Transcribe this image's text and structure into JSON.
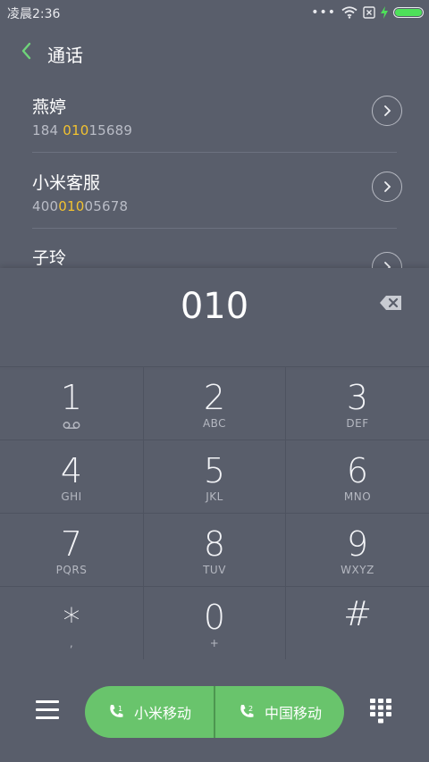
{
  "status_bar": {
    "time": "凌晨2:36",
    "battery_color": "#4ee05a"
  },
  "header": {
    "back_icon": "chevron-left-icon",
    "title": "通话"
  },
  "contacts": [
    {
      "name": "燕婷",
      "num_pre": "184 ",
      "num_hl": "010",
      "num_post": "15689"
    },
    {
      "name": "小米客服",
      "num_pre": "400",
      "num_hl": "010",
      "num_post": "05678"
    },
    {
      "name": "子玲",
      "num_pre": "",
      "num_hl": "",
      "num_post": ""
    }
  ],
  "dial": {
    "digits": "010",
    "delete_icon": "backspace-icon"
  },
  "keypad": [
    {
      "num": "1",
      "letters": ""
    },
    {
      "num": "2",
      "letters": "ABC"
    },
    {
      "num": "3",
      "letters": "DEF"
    },
    {
      "num": "4",
      "letters": "GHI"
    },
    {
      "num": "5",
      "letters": "JKL"
    },
    {
      "num": "6",
      "letters": "MNO"
    },
    {
      "num": "7",
      "letters": "PQRS"
    },
    {
      "num": "8",
      "letters": "TUV"
    },
    {
      "num": "9",
      "letters": "WXYZ"
    },
    {
      "num": "*",
      "letters": ","
    },
    {
      "num": "0",
      "letters": "+"
    },
    {
      "num": "#",
      "letters": ""
    }
  ],
  "call_bar": {
    "sim1_label": "小米移动",
    "sim2_label": "中国移动",
    "sim1_index": "1",
    "sim2_index": "2",
    "accent": "#69c46c"
  },
  "colors": {
    "background": "#595e6b",
    "highlight": "#f2c230"
  }
}
